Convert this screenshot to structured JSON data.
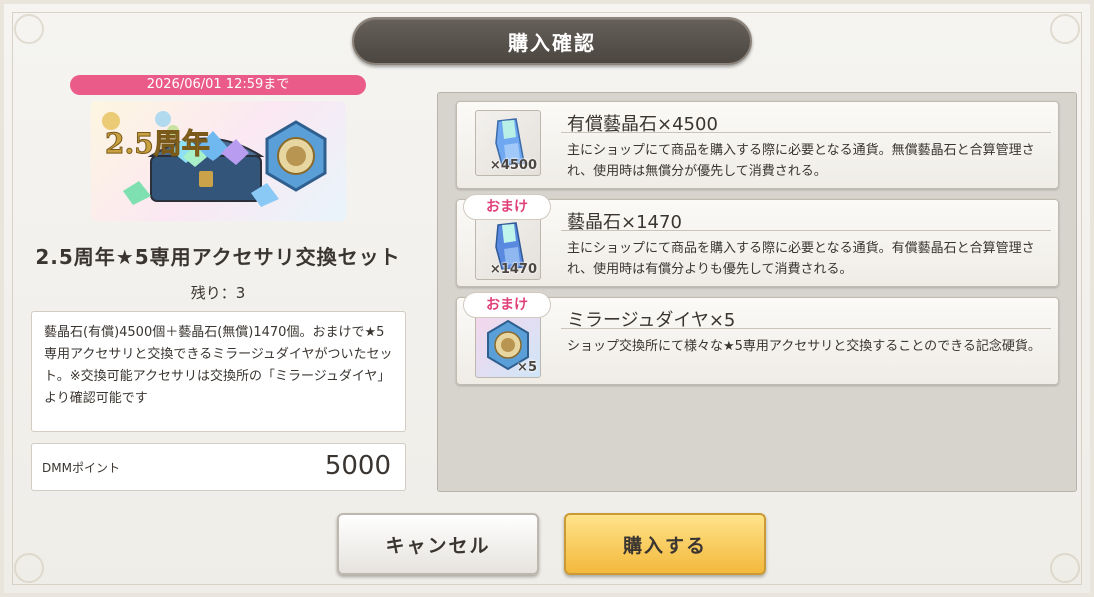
{
  "dialog": {
    "title": "購入確認"
  },
  "product": {
    "deadline": "2026/06/01 12:59まで",
    "name": "2.5周年★5専用アクセサリ交換セット",
    "remaining": "残り：3",
    "description": "藝晶石(有償)4500個＋藝晶石(無償)1470個。おまけで★5専用アクセサリと交換できるミラージュダイヤがついたセット。※交換可能アクセサリは交換所の「ミラージュダイヤ」より確認可能です",
    "banner_text": "2.5周年"
  },
  "points": {
    "label": "DMMポイント",
    "value": "5000"
  },
  "items": [
    {
      "name": "有償藝晶石×4500",
      "count": "×4500",
      "desc": "主にショップにて商品を購入する際に必要となる通貨。無償藝晶石と合算管理され、使用時は無償分が優先して消費される。"
    },
    {
      "badge": "おまけ",
      "name": "藝晶石×1470",
      "count": "×1470",
      "desc": "主にショップにて商品を購入する際に必要となる通貨。有償藝晶石と合算管理され、使用時は有償分よりも優先して消費される。"
    },
    {
      "badge": "おまけ",
      "name": "ミラージュダイヤ×5",
      "count": "×5",
      "desc": "ショップ交換所にて様々な★5専用アクセサリと交換することのできる記念硬貨。"
    }
  ],
  "buttons": {
    "cancel": "キャンセル",
    "buy": "購入する"
  },
  "colors": {
    "accent_pink": "#ea5b8a",
    "buy_gold": "#f3b93c",
    "title_bar": "#4c4641"
  }
}
